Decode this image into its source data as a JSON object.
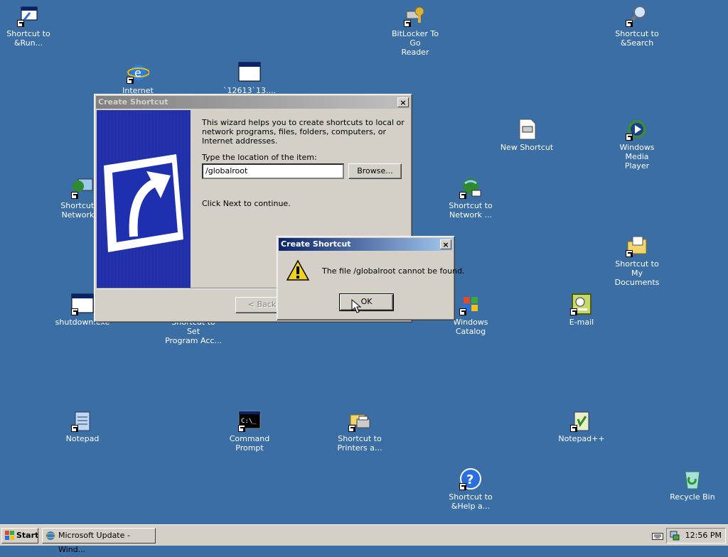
{
  "desktop": {
    "icons": [
      {
        "label": "Shortcut to\n&Run..."
      },
      {
        "label": "BitLocker To Go\nReader"
      },
      {
        "label": "Shortcut to\n&Search"
      },
      {
        "label": "Internet"
      },
      {
        "label": "`12613`13...."
      },
      {
        "label": "New Shortcut"
      },
      {
        "label": "Windows Media\nPlayer"
      },
      {
        "label": "Shortcut to\nNetwork Pl"
      },
      {
        "label": "Shortcut to\nNetwork ..."
      },
      {
        "label": "Shortcut to My\nDocuments"
      },
      {
        "label": "shutdown.exe"
      },
      {
        "label": "Shortcut to Set\nProgram Acc..."
      },
      {
        "label": "Windows\nCatalog"
      },
      {
        "label": "E-mail"
      },
      {
        "label": "Notepad"
      },
      {
        "label": "Command\nPrompt"
      },
      {
        "label": "Shortcut to\nPrinters a..."
      },
      {
        "label": "Notepad++"
      },
      {
        "label": "Shortcut to\n&Help a..."
      },
      {
        "label": "Recycle Bin"
      }
    ]
  },
  "wizard": {
    "title": "Create Shortcut",
    "intro": "This wizard helps you to create shortcuts to local or network programs, files, folders, computers, or Internet addresses.",
    "location_label": "Type the location of the item:",
    "location_value": "/globalroot",
    "browse_label": "Browse...",
    "continue_text": "Click Next to continue.",
    "back_label": "< Back",
    "close_label": "×"
  },
  "error_dialog": {
    "title": "Create Shortcut",
    "message": "The file /globalroot cannot be found.",
    "ok_label": "OK",
    "close_label": "×"
  },
  "taskbar": {
    "start_label": "Start",
    "task_label": "Microsoft Update - Wind...",
    "clock": "12:56 PM"
  },
  "colors": {
    "desktop": "#3a6ea5",
    "title_active": "#0a246a",
    "title_inactive": "#808080"
  }
}
